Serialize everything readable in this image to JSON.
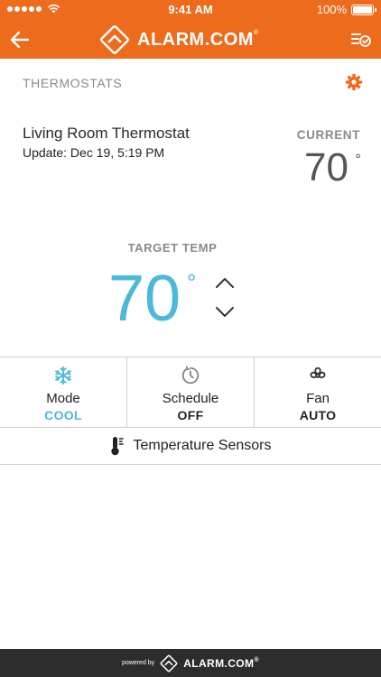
{
  "status_bar": {
    "time": "9:41 AM",
    "battery_percent": "100%",
    "battery_level": 1.0
  },
  "header": {
    "brand": "ALARM.COM",
    "trademark": "®",
    "back_icon": "arrow-left-icon",
    "tasks_icon": "list-check-icon",
    "logo_icon": "alarm-house-logo"
  },
  "section": {
    "title": "THERMOSTATS",
    "settings_icon": "gear-icon"
  },
  "device": {
    "name": "Living Room Thermostat",
    "update": "Update: Dec 19, 5:19 PM",
    "current_label": "CURRENT",
    "current_temp": "70",
    "degree": "°"
  },
  "target": {
    "label": "TARGET TEMP",
    "temp": "70",
    "degree": "°",
    "increase_icon": "chevron-up-icon",
    "decrease_icon": "chevron-down-icon"
  },
  "controls": [
    {
      "label": "Mode",
      "value": "COOL",
      "icon": "snowflake-icon"
    },
    {
      "label": "Schedule",
      "value": "OFF",
      "icon": "schedule-clock-icon"
    },
    {
      "label": "Fan",
      "value": "AUTO",
      "icon": "fan-icon"
    }
  ],
  "sensors": {
    "label": "Temperature Sensors",
    "icon": "thermometer-icon"
  },
  "footer": {
    "powered_by": "powered by",
    "brand": "ALARM.COM",
    "trademark": "®"
  },
  "colors": {
    "header": "#ec6b1c",
    "accent": "#4cb9d9",
    "footer": "#2d2d2d",
    "gear": "#ec6b1c"
  }
}
